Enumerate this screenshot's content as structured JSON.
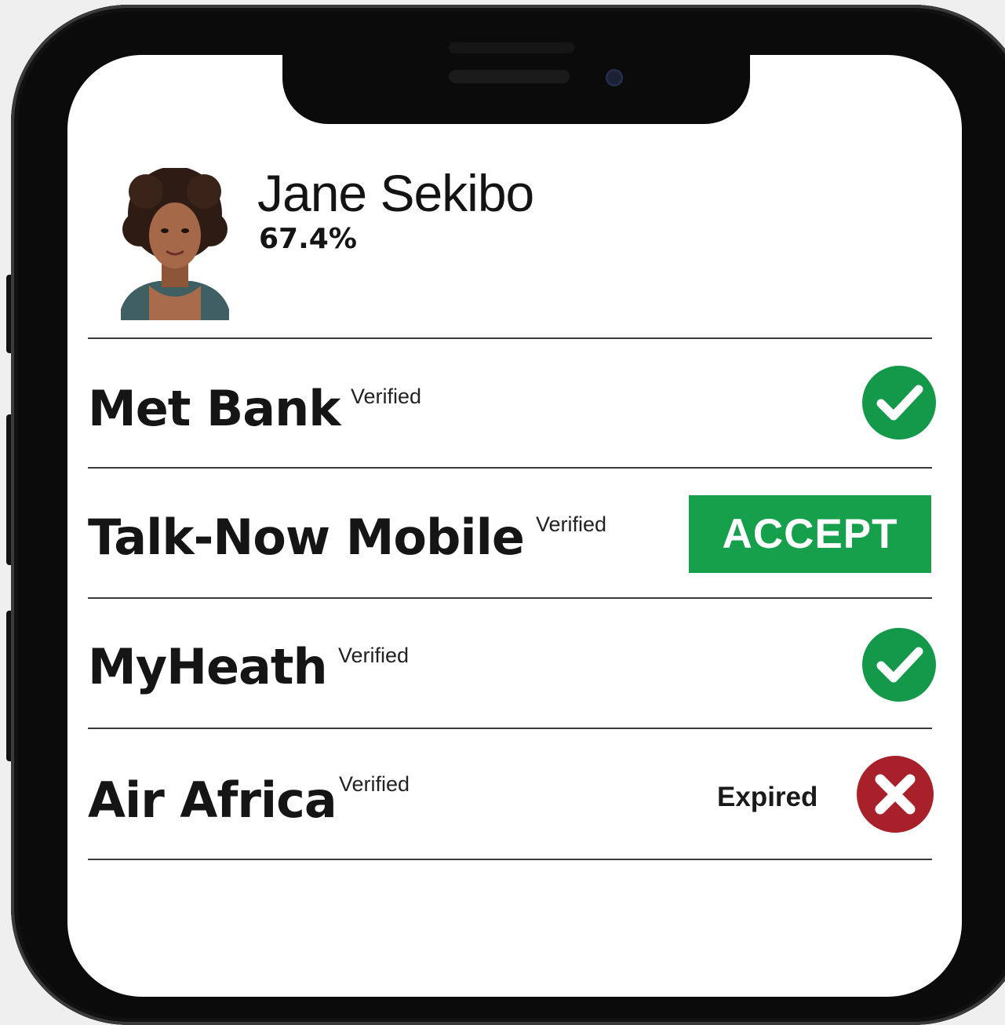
{
  "profile": {
    "name": "Jane Sekibo",
    "score": "67.4%"
  },
  "accounts": [
    {
      "name": "Met Bank",
      "badge": "Verified",
      "status": "verified",
      "status_icon": "check-circle-icon"
    },
    {
      "name": "Talk-Now Mobile",
      "badge": "Verified",
      "status": "pending",
      "action_label": "ACCEPT"
    },
    {
      "name": "MyHeath",
      "badge": "Verified",
      "status": "verified",
      "status_icon": "check-circle-icon"
    },
    {
      "name": "Air Africa",
      "badge": "Verified",
      "status": "expired",
      "status_label": "Expired",
      "status_icon": "x-circle-icon"
    }
  ],
  "colors": {
    "verified": "#14994b",
    "accept": "#17a04c",
    "expired": "#a8202a",
    "frame": "#0b0b0b"
  }
}
